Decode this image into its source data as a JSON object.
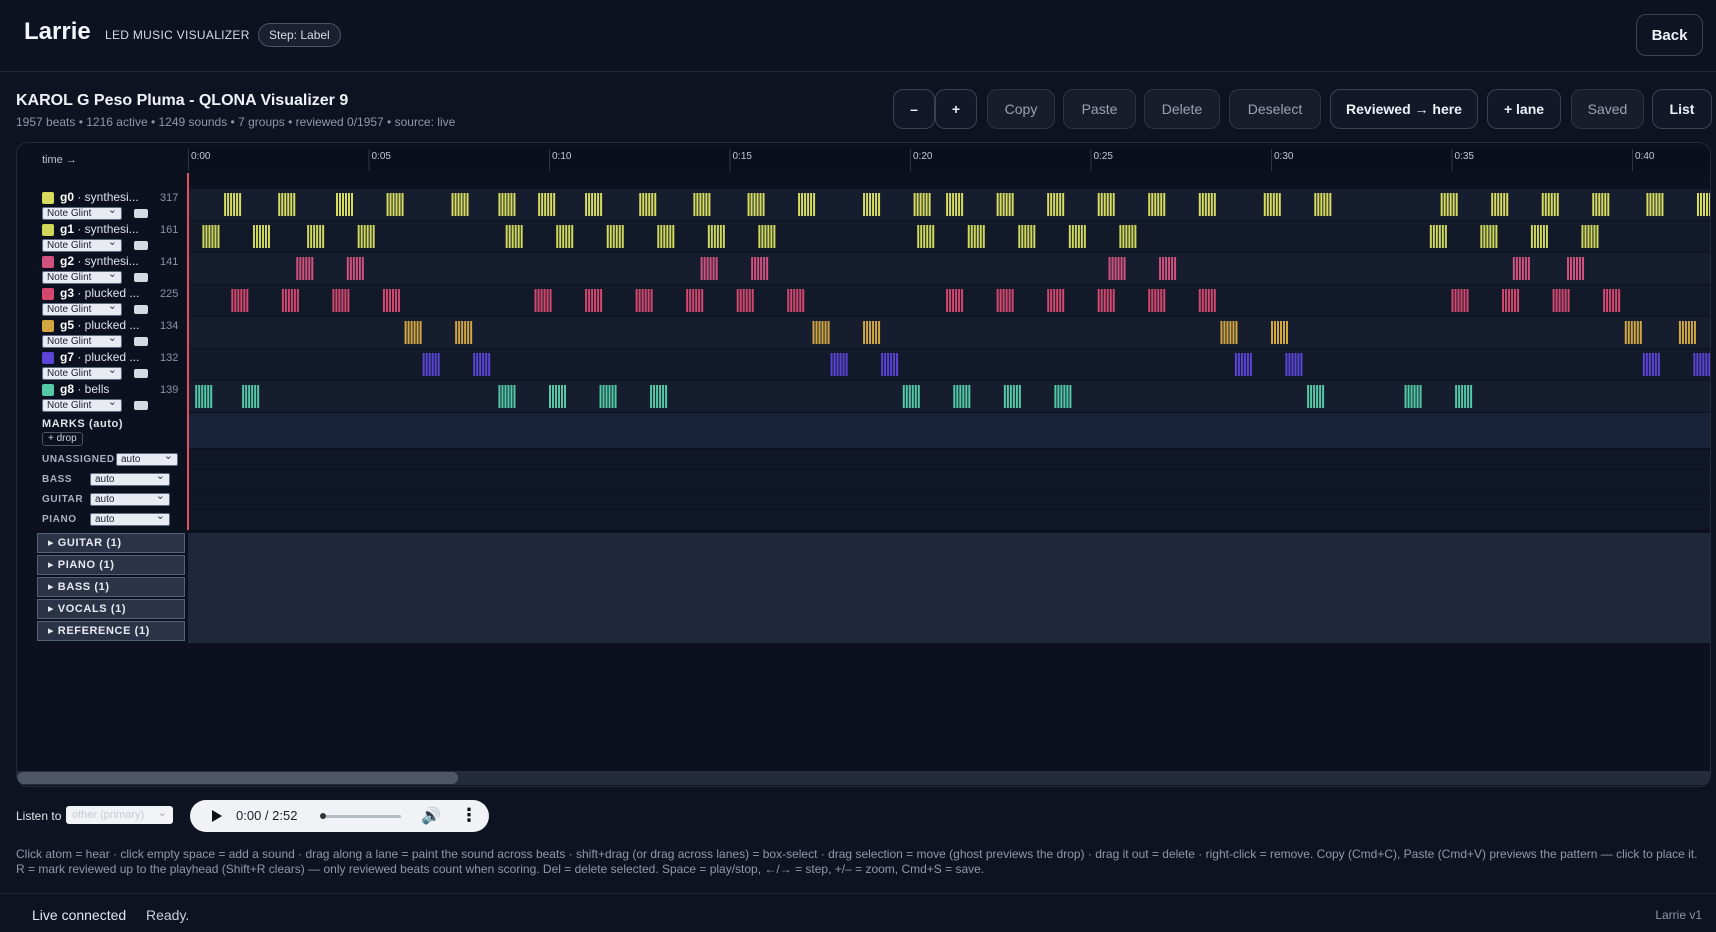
{
  "app": {
    "title": "Larrie",
    "subtitle": "LED MUSIC VISUALIZER",
    "step": "Step: Label",
    "back_label": "Back"
  },
  "project": {
    "title": "KAROL G Peso Pluma - QLONA Visualizer 9",
    "meta": "1957 beats • 1216 active • 1249 sounds • 7 groups • reviewed 0/1957 • source: live"
  },
  "toolbar": {
    "zoom_out": "–",
    "zoom_in": "+",
    "copy": "Copy",
    "paste": "Paste",
    "delete": "Delete",
    "deselect": "Deselect",
    "reviewed_here": "Reviewed → here",
    "add_lane": "+ lane",
    "saved": "Saved",
    "list": "List"
  },
  "timeline": {
    "header_label": "time →",
    "ticks": [
      "0:00",
      "0:05",
      "0:10",
      "0:15",
      "0:20",
      "0:25",
      "0:30",
      "0:35",
      "0:40"
    ],
    "tick_seconds": [
      0,
      5,
      10,
      15,
      20,
      25,
      30,
      35,
      40
    ],
    "lanes": [
      {
        "id": "g0",
        "name": "synthesi...",
        "count": "317",
        "effect": "Note Glint",
        "color": "#d7dc5f",
        "events": [
          1.0,
          2.5,
          4.1,
          5.5,
          7.3,
          8.6,
          9.7,
          11.0,
          12.5,
          14.0,
          15.5,
          16.9,
          18.7,
          20.1,
          21.0,
          22.4,
          23.8,
          25.2,
          26.6,
          28.0,
          29.8,
          31.2,
          34.7,
          36.1,
          37.5,
          38.9,
          40.4,
          41.8
        ]
      },
      {
        "id": "g1",
        "name": "synthesi...",
        "count": "161",
        "effect": "Note Glint",
        "color": "#cfd85a",
        "events": [
          0.4,
          1.8,
          3.3,
          4.7,
          8.8,
          10.2,
          11.6,
          13.0,
          14.4,
          15.8,
          20.2,
          21.6,
          23.0,
          24.4,
          25.8,
          34.4,
          35.8,
          37.2,
          38.6
        ]
      },
      {
        "id": "g2",
        "name": "synthesi...",
        "count": "141",
        "effect": "Note Glint",
        "color": "#d2527f",
        "events": [
          3.0,
          4.4,
          14.2,
          15.6,
          25.5,
          26.9,
          36.7,
          38.2
        ]
      },
      {
        "id": "g3",
        "name": "plucked ...",
        "count": "225",
        "effect": "Note Glint",
        "color": "#d4476e",
        "events": [
          1.2,
          2.6,
          4.0,
          5.4,
          9.6,
          11.0,
          12.4,
          13.8,
          15.2,
          16.6,
          21.0,
          22.4,
          23.8,
          25.2,
          26.6,
          28.0,
          35.0,
          36.4,
          37.8,
          39.2
        ]
      },
      {
        "id": "g5",
        "name": "plucked ...",
        "count": "134",
        "effect": "Note Glint",
        "color": "#d2a640",
        "events": [
          6.0,
          7.4,
          17.3,
          18.7,
          28.6,
          30.0,
          39.8,
          41.3
        ]
      },
      {
        "id": "g7",
        "name": "plucked ...",
        "count": "132",
        "effect": "Note Glint",
        "color": "#5b44d6",
        "events": [
          6.5,
          7.9,
          17.8,
          19.2,
          29.0,
          30.4,
          40.3,
          41.7
        ]
      },
      {
        "id": "g8",
        "name": "bells",
        "count": "139",
        "effect": "Note Glint",
        "color": "#53c9a5",
        "events": [
          0.2,
          1.5,
          8.6,
          10.0,
          11.4,
          12.8,
          19.8,
          21.2,
          22.6,
          24.0,
          31.0,
          33.7,
          35.1
        ]
      }
    ],
    "marks_label": "MARKS (auto)",
    "drop_label": "+ drop",
    "categories": [
      {
        "label": "UNASSIGNED",
        "value": "auto"
      },
      {
        "label": "BASS",
        "value": "auto"
      },
      {
        "label": "GUITAR",
        "value": "auto"
      },
      {
        "label": "PIANO",
        "value": "auto"
      }
    ],
    "groups": [
      "▸ GUITAR (1)",
      "▸ PIANO (1)",
      "▸ BASS (1)",
      "▸ VOCALS (1)",
      "▸ REFERENCE (1)"
    ],
    "scroll_fraction": 0.26
  },
  "listen": {
    "label": "Listen to",
    "value": "other (primary)",
    "time": "0:00 / 2:52",
    "progress": 0
  },
  "help": "Click atom = hear · click empty space = add a sound · drag along a lane = paint the sound across beats · shift+drag (or drag across lanes) = box-select · drag selection = move (ghost previews the drop) · drag it out = delete · right-click = remove. Copy (Cmd+C), Paste (Cmd+V) previews the pattern — click to place it. R = mark reviewed up to the playhead (Shift+R clears) — only reviewed beats count when scoring. Del = delete selected. Space = play/stop, ←/→ = step, +/– = zoom, Cmd+S = save.",
  "status": {
    "connection": "Live connected",
    "state": "Ready.",
    "version": "Larrie v1"
  }
}
